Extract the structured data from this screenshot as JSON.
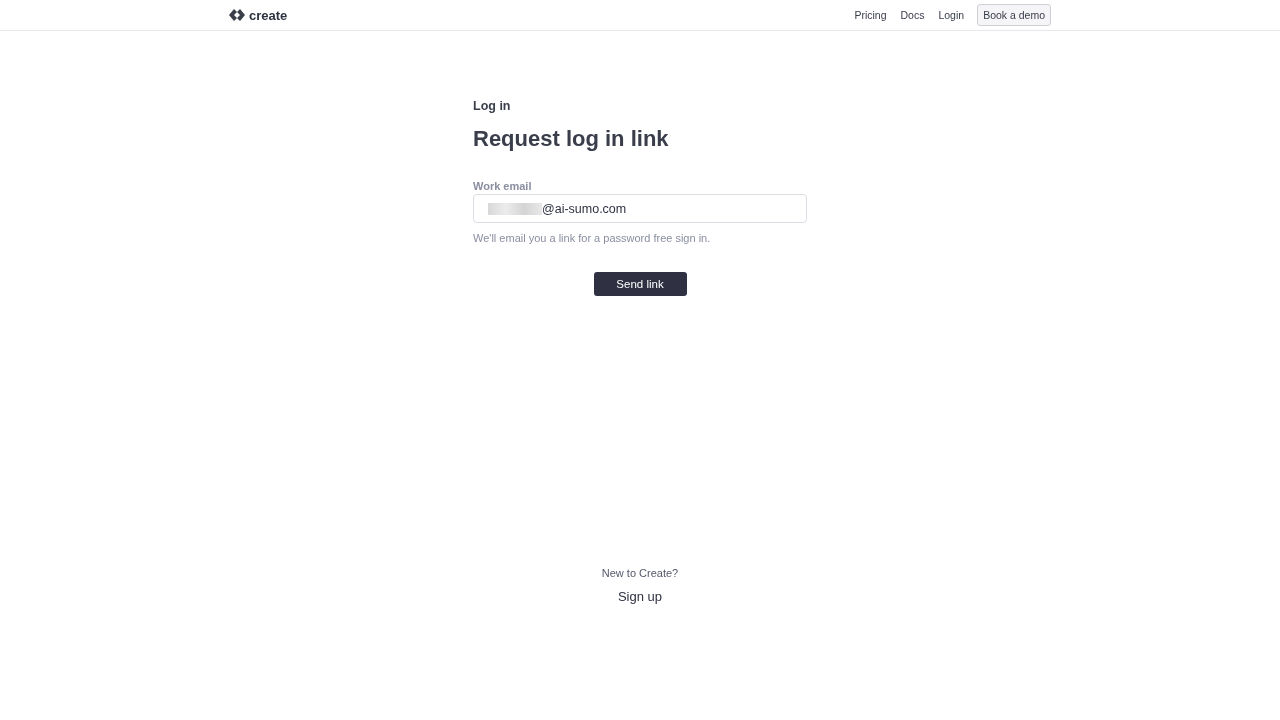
{
  "header": {
    "logo": "create",
    "nav": [
      {
        "label": "Pricing",
        "kind": "link"
      },
      {
        "label": "Docs",
        "kind": "link"
      },
      {
        "label": "Login",
        "kind": "link"
      },
      {
        "label": "Book a demo",
        "kind": "button"
      }
    ]
  },
  "form": {
    "eyebrow": "Log in",
    "title": "Request log in link",
    "field_label": "Work email",
    "email_value": "@ai-sumo.com",
    "email_redacted": true,
    "hint": "We'll email you a link for a password free sign in.",
    "submit": "Send link"
  },
  "footer": {
    "prompt": "New to Create?",
    "link": "Sign up"
  }
}
